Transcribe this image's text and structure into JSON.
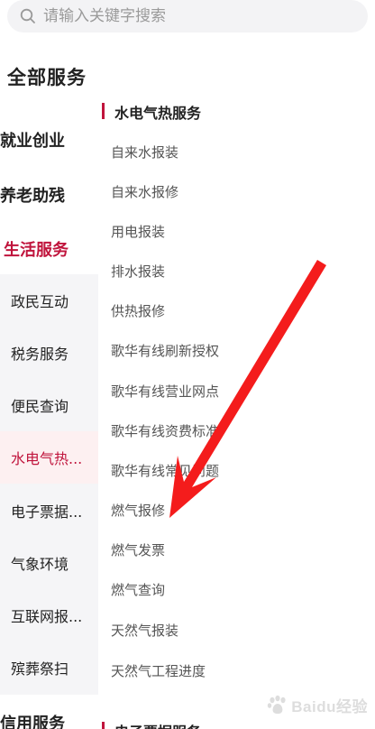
{
  "search": {
    "placeholder": "请输入关键字搜索"
  },
  "page_title": "全部服务",
  "categories": [
    {
      "label": "就业创业"
    },
    {
      "label": "养老助残"
    },
    {
      "label": "生活服务"
    },
    {
      "label": "信用服务"
    }
  ],
  "sub_categories": [
    {
      "label": "政民互动"
    },
    {
      "label": "税务服务"
    },
    {
      "label": "便民查询"
    },
    {
      "label": "水电气热..."
    },
    {
      "label": "电子票据..."
    },
    {
      "label": "气象环境"
    },
    {
      "label": "互联网报..."
    },
    {
      "label": "殡葬祭扫"
    }
  ],
  "section": {
    "title": "水电气热服务",
    "items": [
      {
        "label": "自来水报装"
      },
      {
        "label": "自来水报修"
      },
      {
        "label": "用电报装"
      },
      {
        "label": "排水报装"
      },
      {
        "label": "供热报修"
      },
      {
        "label": "歌华有线刷新授权"
      },
      {
        "label": "歌华有线营业网点"
      },
      {
        "label": "歌华有线资费标准"
      },
      {
        "label": "歌华有线常见问题"
      },
      {
        "label": "燃气报修"
      },
      {
        "label": "燃气发票"
      },
      {
        "label": "燃气查询"
      },
      {
        "label": "天然气报装"
      },
      {
        "label": "天然气工程进度"
      }
    ]
  },
  "next_section": {
    "title": "电子票据服务"
  },
  "watermark": {
    "text": "Baidu经验"
  },
  "colors": {
    "accent": "#c0143c",
    "annotation_arrow": "#f41c1c"
  },
  "icons": {
    "search": "search-icon"
  }
}
